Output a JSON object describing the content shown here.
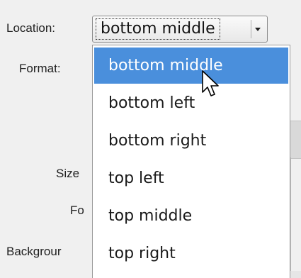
{
  "form": {
    "location_label": "Location:",
    "format_label": "Format:",
    "size_label": "Size",
    "font_label": "Fo",
    "background_label": "Backgrour"
  },
  "location_combo": {
    "value": "bottom middle",
    "options": [
      "bottom middle",
      "bottom left",
      "bottom right",
      "top left",
      "top middle",
      "top right"
    ],
    "highlighted_option": "bottom middle"
  },
  "colors": {
    "highlight": "#4a8fdc",
    "highlight_text": "#ffffff",
    "background": "#f0f0f0"
  },
  "cursor": {
    "icon": "arrow-pointer-icon"
  }
}
